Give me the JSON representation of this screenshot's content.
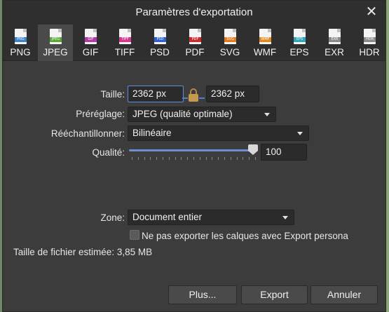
{
  "window": {
    "title": "Paramètres d'exportation",
    "close_glyph": "✕"
  },
  "tabs": [
    {
      "label": "PNG",
      "icon": "png-file-icon",
      "band": "PNG",
      "color": "#3b83c7"
    },
    {
      "label": "JPEG",
      "icon": "jpeg-file-icon",
      "band": "JPEG",
      "color": "#5aa832"
    },
    {
      "label": "GIF",
      "icon": "gif-file-icon",
      "band": "GIF",
      "color": "#b13aa5"
    },
    {
      "label": "TIFF",
      "icon": "tiff-file-icon",
      "band": "TIFF",
      "color": "#d5368f"
    },
    {
      "label": "PSD",
      "icon": "psd-file-icon",
      "band": "PSD",
      "color": "#2f5fd0"
    },
    {
      "label": "PDF",
      "icon": "pdf-file-icon",
      "band": "PDF",
      "color": "#cc2b2b"
    },
    {
      "label": "SVG",
      "icon": "svg-file-icon",
      "band": "SVG",
      "color": "#e07b1e"
    },
    {
      "label": "WMF",
      "icon": "wmf-file-icon",
      "band": "WMF",
      "color": "#e08a1e"
    },
    {
      "label": "EPS",
      "icon": "eps-file-icon",
      "band": "EPS",
      "color": "#2fa6b6"
    },
    {
      "label": "EXR",
      "icon": "exr-file-icon",
      "band": "EXR",
      "color": "#8a8a8a"
    },
    {
      "label": "HDR",
      "icon": "hdr-file-icon",
      "band": "HDR",
      "color": "#8a8a8a"
    }
  ],
  "active_tab": "JPEG",
  "form": {
    "size_label": "Taille:",
    "width_value": "2362 px",
    "height_value": "2362 px",
    "size_locked": true,
    "preset_label": "Préréglage:",
    "preset_value": "JPEG (qualité optimale)",
    "resample_label": "Rééchantillonner:",
    "resample_value": "Bilinéaire",
    "quality_label": "Qualité:",
    "quality_value": "100",
    "quality_fraction": 1.0,
    "area_label": "Zone:",
    "area_value": "Document entier",
    "checkbox_label": "Ne pas exporter les calques avec Export persona",
    "checkbox_checked": false,
    "filesize_label": "Taille de fichier estimée:",
    "filesize_value": "3,85 MB"
  },
  "buttons": {
    "more": "Plus...",
    "export": "Export",
    "cancel": "Annuler"
  },
  "colors": {
    "accent": "#5d8fd6",
    "slider": "#6c8fcf"
  }
}
